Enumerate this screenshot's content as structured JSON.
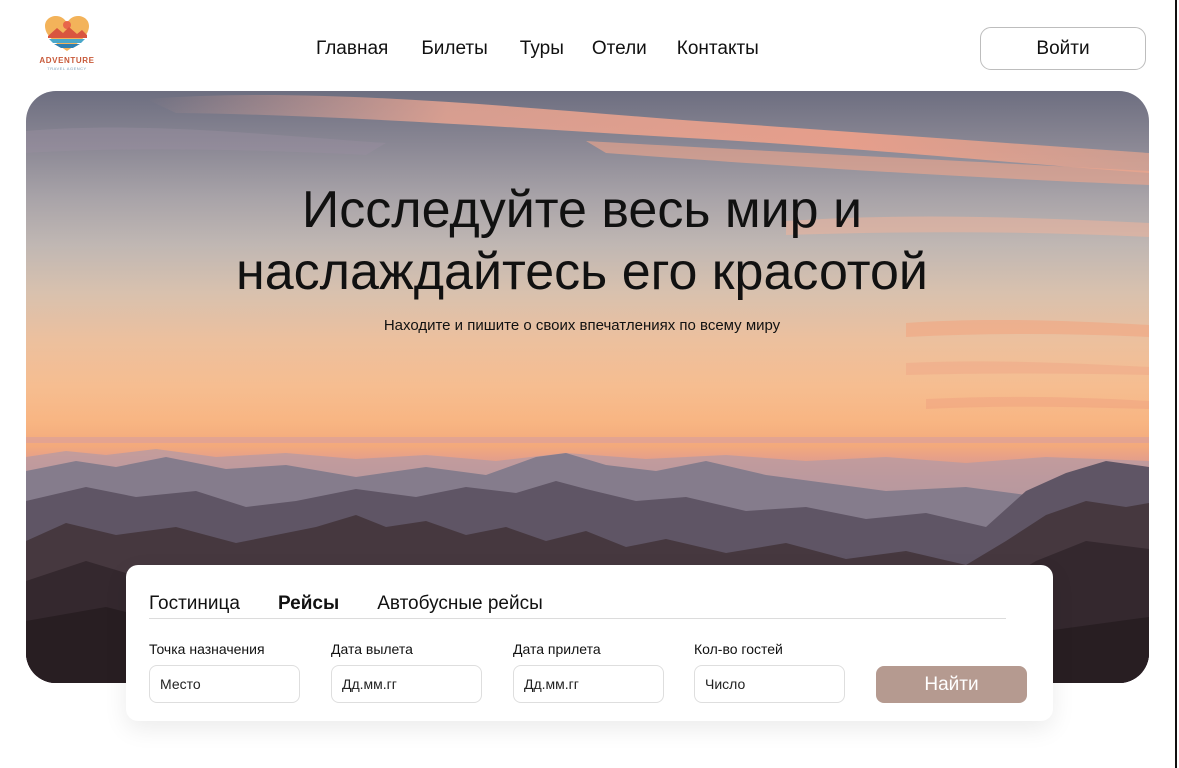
{
  "brand": {
    "name": "ADVENTURE",
    "tagline": "TRAVEL AGENCY"
  },
  "nav": {
    "items": [
      "Главная",
      "Билеты",
      "Туры",
      "Отели",
      "Контакты"
    ]
  },
  "header": {
    "login_label": "Войти"
  },
  "hero": {
    "title_line1": "Исследуйте весь мир и",
    "title_line2": "наслаждайтесь его красотой",
    "subtitle": "Находите и пишите о своих впечатлениях по всему миру"
  },
  "search": {
    "tabs": [
      "Гостиница",
      "Рейсы",
      "Автобусные рейсы"
    ],
    "active_tab": "Рейсы",
    "fields": [
      {
        "label": "Точка назначения",
        "placeholder": "Место"
      },
      {
        "label": "Дата вылета",
        "placeholder": "Дд.мм.гг"
      },
      {
        "label": "Дата прилета",
        "placeholder": "Дд.мм.гг"
      },
      {
        "label": "Кол-во гостей",
        "placeholder": "Число"
      }
    ],
    "submit_label": "Найти"
  },
  "colors": {
    "accent": "#b59a90",
    "brand": "#c85a3a"
  }
}
